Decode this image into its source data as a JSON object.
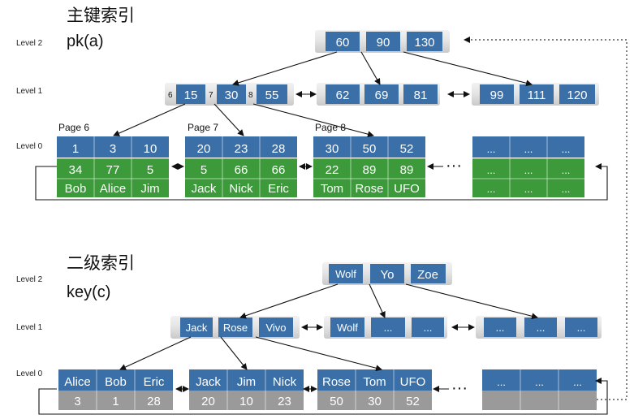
{
  "primary": {
    "title": "主键索引",
    "subtitle": "pk(a)",
    "levels": [
      "Level 2",
      "Level 1",
      "Level 0"
    ],
    "root": [
      "60",
      "90",
      "130"
    ],
    "internal": [
      [
        "15",
        "30",
        "55"
      ],
      [
        "62",
        "69",
        "81"
      ],
      [
        "99",
        "111",
        "120"
      ]
    ],
    "pointer_labels": [
      "6",
      "7",
      "8"
    ],
    "page_labels": [
      "Page 6",
      "Page 7",
      "Page 8"
    ],
    "leaves": [
      {
        "keys": [
          "1",
          "3",
          "10"
        ],
        "b": [
          "34",
          "77",
          "5"
        ],
        "c": [
          "Bob",
          "Alice",
          "Jim"
        ]
      },
      {
        "keys": [
          "20",
          "23",
          "28"
        ],
        "b": [
          "5",
          "66",
          "66"
        ],
        "c": [
          "Jack",
          "Nick",
          "Eric"
        ]
      },
      {
        "keys": [
          "30",
          "50",
          "52"
        ],
        "b": [
          "22",
          "89",
          "89"
        ],
        "c": [
          "Tom",
          "Rose",
          "UFO"
        ]
      },
      {
        "keys": [
          "...",
          "...",
          "..."
        ],
        "b": [
          "...",
          "...",
          "..."
        ],
        "c": [
          "...",
          "...",
          "..."
        ]
      }
    ],
    "ellipsis": "···"
  },
  "secondary": {
    "title": "二级索引",
    "subtitle": "key(c)",
    "levels": [
      "Level 2",
      "Level 1",
      "Level 0"
    ],
    "root": [
      "Wolf",
      "Yo",
      "Zoe"
    ],
    "internal": [
      [
        "Jack",
        "Rose",
        "Vivo"
      ],
      [
        "Wolf",
        "...",
        "..."
      ],
      [
        "...",
        "...",
        "..."
      ]
    ],
    "leaves": [
      {
        "keys": [
          "Alice",
          "Bob",
          "Eric"
        ],
        "pk": [
          "3",
          "1",
          "28"
        ]
      },
      {
        "keys": [
          "Jack",
          "Jim",
          "Nick"
        ],
        "pk": [
          "20",
          "10",
          "23"
        ]
      },
      {
        "keys": [
          "Rose",
          "Tom",
          "UFO"
        ],
        "pk": [
          "50",
          "30",
          "52"
        ]
      },
      {
        "keys": [
          "...",
          "...",
          "..."
        ],
        "pk": [
          "",
          "",
          ""
        ]
      }
    ],
    "ellipsis": "···"
  },
  "colors": {
    "key_cell": "#3a6fa7",
    "row_cell": "#3c9a3a",
    "pk_cell": "#9a9a9a"
  }
}
